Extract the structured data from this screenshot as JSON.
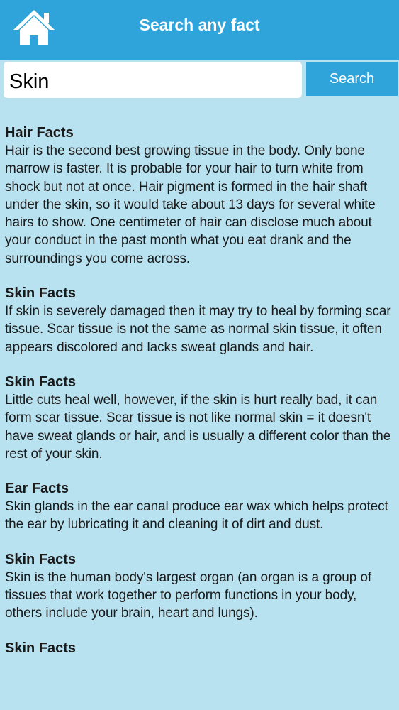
{
  "header": {
    "title": "Search any fact",
    "home_icon": "home-icon"
  },
  "search": {
    "value": "Skin",
    "button_label": "Search"
  },
  "results": [
    {
      "title": "Hair Facts",
      "text": "Hair is the second best growing tissue in the body. Only bone marrow is faster. It is probable for your hair to turn white from shock but not at once. Hair pigment is formed in the hair shaft under the skin, so it would take about 13 days for several white hairs to show. One centimeter of hair can disclose much about your conduct in the past month what you eat drank and the surroundings you come across."
    },
    {
      "title": "Skin Facts",
      "text": "If skin is severely damaged then it may try to heal by forming scar tissue. Scar tissue is not the same as normal skin tissue, it often appears discolored and lacks sweat glands and hair."
    },
    {
      "title": "Skin Facts",
      "text": "Little cuts heal well, however, if the skin is hurt really bad, it can form scar tissue. Scar tissue is not like normal skin = it doesn't have sweat glands or hair, and is usually a different color than the rest of your skin."
    },
    {
      "title": "Ear Facts",
      "text": "Skin glands in the ear canal produce ear wax which helps protect the ear by lubricating it and cleaning it of dirt and dust."
    },
    {
      "title": "Skin Facts",
      "text": "Skin is the human body's largest organ (an organ is a group of tissues that work together to perform functions in your body, others include your brain, heart and lungs)."
    },
    {
      "title": "Skin Facts",
      "text": ""
    }
  ],
  "colors": {
    "header_bg": "#2ea4db",
    "page_bg": "#b9e2f0",
    "text": "#1a1a1a"
  }
}
